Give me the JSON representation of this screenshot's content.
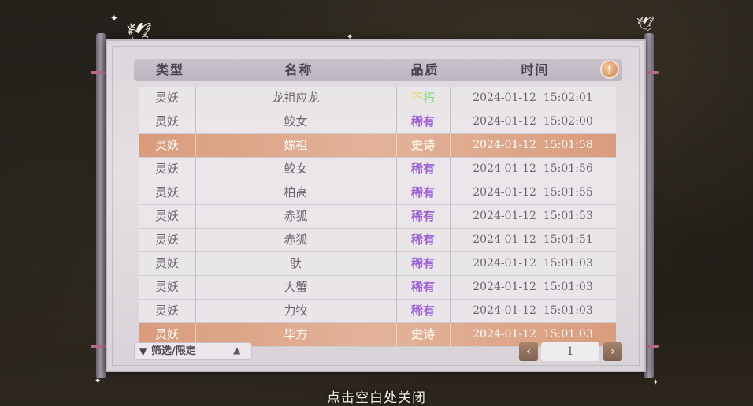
{
  "header": {
    "col_type": "类型",
    "col_name": "名称",
    "col_quality": "品质",
    "col_time": "时间",
    "info_icon": "!"
  },
  "rows": [
    {
      "type": "灵妖",
      "name": "龙祖应龙",
      "quality": "不朽",
      "time": "2024-01-12  15:02:01",
      "tier": "immortal"
    },
    {
      "type": "灵妖",
      "name": "鲛女",
      "quality": "稀有",
      "time": "2024-01-12  15:02:00",
      "tier": "rare"
    },
    {
      "type": "灵妖",
      "name": "嫘祖",
      "quality": "史诗",
      "time": "2024-01-12  15:01:58",
      "tier": "epic"
    },
    {
      "type": "灵妖",
      "name": "鲛女",
      "quality": "稀有",
      "time": "2024-01-12  15:01:56",
      "tier": "rare"
    },
    {
      "type": "灵妖",
      "name": "柏高",
      "quality": "稀有",
      "time": "2024-01-12  15:01:55",
      "tier": "rare"
    },
    {
      "type": "灵妖",
      "name": "赤狐",
      "quality": "稀有",
      "time": "2024-01-12  15:01:53",
      "tier": "rare"
    },
    {
      "type": "灵妖",
      "name": "赤狐",
      "quality": "稀有",
      "time": "2024-01-12  15:01:51",
      "tier": "rare"
    },
    {
      "type": "灵妖",
      "name": "驮",
      "quality": "稀有",
      "time": "2024-01-12  15:01:03",
      "tier": "rare"
    },
    {
      "type": "灵妖",
      "name": "大蟹",
      "quality": "稀有",
      "time": "2024-01-12  15:01:03",
      "tier": "rare"
    },
    {
      "type": "灵妖",
      "name": "力牧",
      "quality": "稀有",
      "time": "2024-01-12  15:01:03",
      "tier": "rare"
    },
    {
      "type": "灵妖",
      "name": "毕方",
      "quality": "史诗",
      "time": "2024-01-12  15:01:03",
      "tier": "epic"
    }
  ],
  "filter": {
    "label": "筛选/限定",
    "icon": "filter-icon",
    "arrow": "chevron-up-icon"
  },
  "pagination": {
    "page": "1",
    "prev": "‹",
    "next": "›"
  },
  "hint": "点击空白处关闭",
  "colors": {
    "rare": "#9b5fd8",
    "epic_row": "#d99c7c",
    "header": "#bcb5c0"
  }
}
